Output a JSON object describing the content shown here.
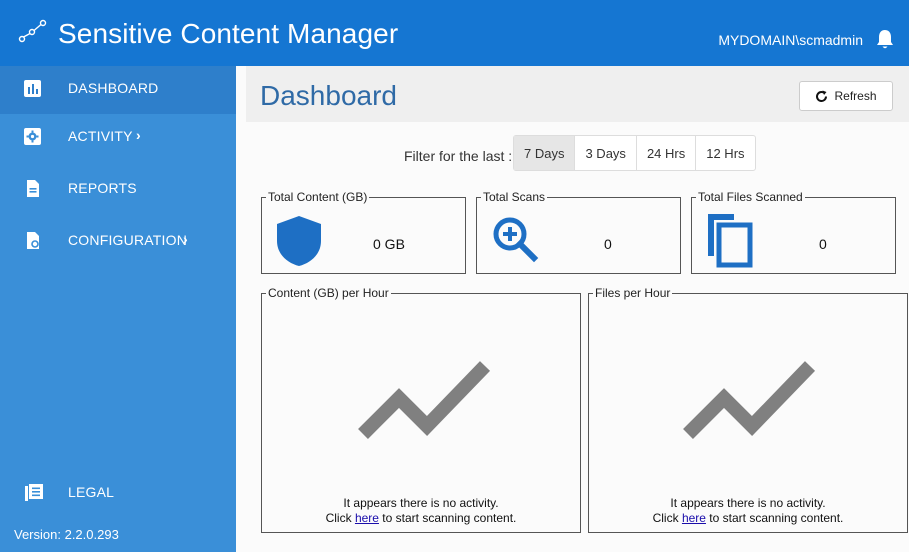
{
  "header": {
    "app_title": "Sensitive Content Manager",
    "user": "MYDOMAIN\\scmadmin",
    "bg_color": "#1576d2"
  },
  "sidebar": {
    "items": [
      {
        "label": "DASHBOARD",
        "icon": "bar-chart-icon",
        "active": true
      },
      {
        "label": "ACTIVITY",
        "icon": "gear-icon",
        "has_submenu": true
      },
      {
        "label": "REPORTS",
        "icon": "document-icon"
      },
      {
        "label": "CONFIGURATION",
        "icon": "cog-document-icon",
        "has_submenu": true
      },
      {
        "label": "LEGAL",
        "icon": "legal-document-icon"
      }
    ],
    "version": "Version: 2.2.0.293",
    "bg_color": "#3a8fd8"
  },
  "main": {
    "title": "Dashboard",
    "refresh_label": "Refresh",
    "filter": {
      "label": "Filter for the last :",
      "options": [
        "7 Days",
        "3 Days",
        "24 Hrs",
        "12 Hrs"
      ],
      "selected": "7 Days"
    },
    "stats": [
      {
        "legend": "Total Content (GB)",
        "value": "0 GB",
        "icon": "shield-icon"
      },
      {
        "legend": "Total Scans",
        "value": "0",
        "icon": "zoom-in-icon"
      },
      {
        "legend": "Total Files Scanned",
        "value": "0",
        "icon": "copy-files-icon"
      }
    ],
    "charts": [
      {
        "legend": "Content (GB) per Hour",
        "message": "It appears there is no activity.",
        "link_prefix": "Click ",
        "link_text": "here",
        "link_suffix": " to start scanning content."
      },
      {
        "legend": "Files per Hour",
        "message": "It appears there is no activity.",
        "link_prefix": "Click ",
        "link_text": "here",
        "link_suffix": " to start scanning content."
      }
    ],
    "accent_color": "#1e6fc4"
  }
}
